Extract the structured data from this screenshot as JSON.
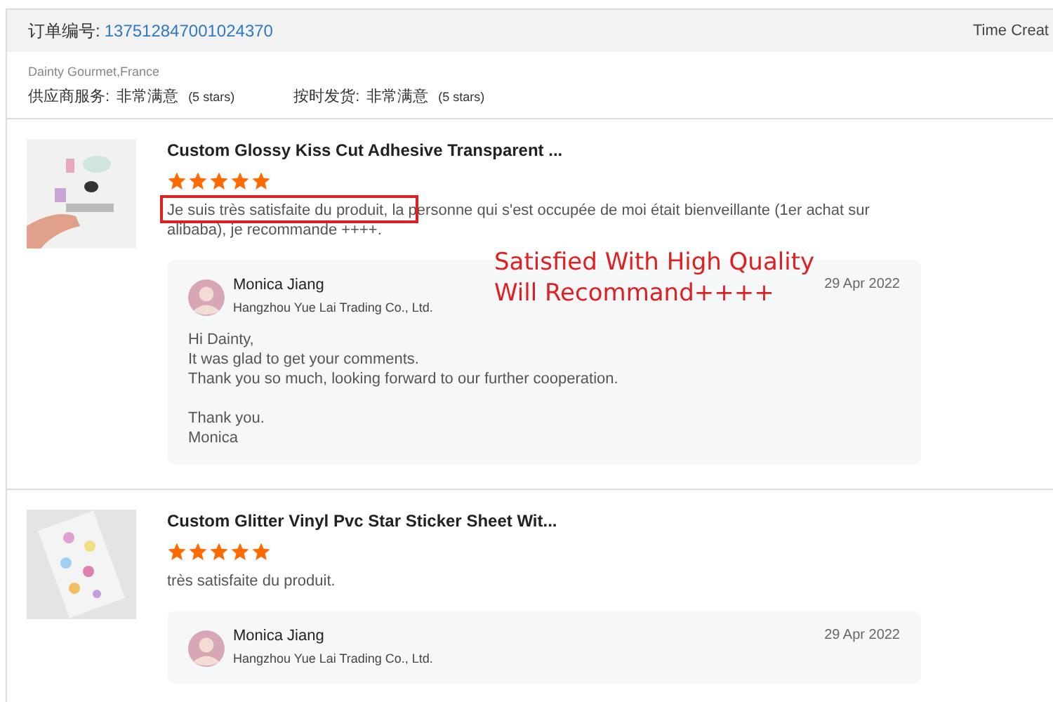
{
  "header": {
    "order_label": "订单编号:",
    "order_number": "137512847001024370",
    "time_label": "Time Creat"
  },
  "buyer": {
    "name": "Dainty Gourmet,France",
    "ratings": [
      {
        "label": "供应商服务:",
        "value": "非常满意",
        "stars": "(5 stars)"
      },
      {
        "label": "按时发货:",
        "value": "非常满意",
        "stars": "(5 stars)"
      }
    ]
  },
  "reviews": [
    {
      "title": "Custom Glossy Kiss Cut Adhesive Transparent ...",
      "stars": 5,
      "comment": "Je suis très satisfaite du produit, la personne qui s'est occupée de moi était bienveillante (1er achat sur alibaba), je recommande ++++.",
      "highlighted": true,
      "reply": {
        "name": "Monica Jiang",
        "company": "Hangzhou Yue Lai Trading Co., Ltd.",
        "date": "29 Apr 2022",
        "message": [
          [
            "Hi Dainty,",
            "It was glad to get your comments.",
            "Thank you so much, looking forward to our further cooperation."
          ],
          [
            "Thank you.",
            "Monica"
          ]
        ]
      }
    },
    {
      "title": "Custom Glitter Vinyl Pvc Star Sticker Sheet Wit...",
      "stars": 5,
      "comment": "très satisfaite du produit.",
      "highlighted": false,
      "reply": {
        "name": "Monica Jiang",
        "company": "Hangzhou Yue Lai Trading Co., Ltd.",
        "date": "29 Apr 2022"
      }
    }
  ],
  "annotation": {
    "lines": [
      "Satisfied With High Quality",
      "Will Recommand++++"
    ]
  }
}
